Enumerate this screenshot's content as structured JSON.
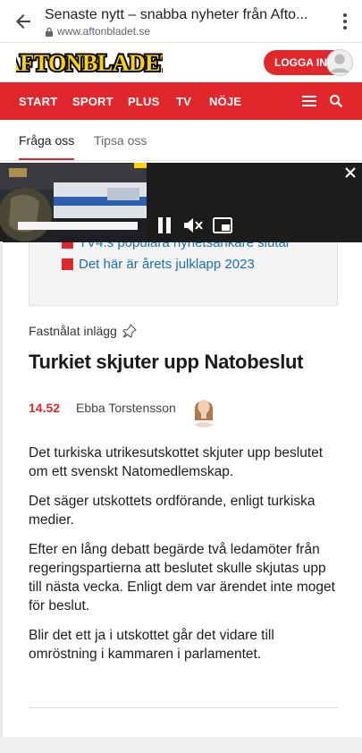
{
  "browser": {
    "page_title": "Senaste nytt – snabba nyheter från Afto...",
    "url": "www.aftonbladet.se"
  },
  "header": {
    "logo_text": "AFTONBLADET",
    "login_label": "LOGGA IN"
  },
  "nav": {
    "items": [
      "START",
      "SPORT",
      "PLUS",
      "TV",
      "NÖJE"
    ]
  },
  "subnav": {
    "tabs": [
      "Fråga oss",
      "Tipsa oss"
    ]
  },
  "related": {
    "links": [
      "TV4:s populära nyhetsankare slutar",
      "Det här är årets julklapp 2023"
    ]
  },
  "article": {
    "pinned_label": "Fastnålat inlägg",
    "headline": "Turkiet skjuter upp Natobeslut",
    "time": "14.52",
    "author": "Ebba Torstensson",
    "paragraphs": [
      "Det turkiska utrikesutskottet skjuter upp beslutet om ett svenskt Natomedlemskap.",
      "Det säger utskottets ordförande, enligt turkiska medier.",
      "Efter en lång debatt begärde två ledamöter från regeringspartierna att beslutet skulle skjutas upp till nästa vecka. Enligt dem var ärendet inte moget för beslut.",
      "Blir det ett ja i utskottet går det vidare till omröstning i kammaren i parlamentet."
    ]
  },
  "colors": {
    "brand_red": "#e0282c",
    "link_blue": "#1a6fb3",
    "logo_yellow": "#ffd200"
  },
  "icons": {
    "back": "arrow-left-icon",
    "lock": "lock-icon",
    "menu": "kebab-menu-icon",
    "hamburger": "hamburger-icon",
    "search": "search-icon",
    "pin": "pin-icon",
    "pause": "pause-icon",
    "mute": "mute-icon",
    "pip": "picture-in-picture-icon",
    "close": "close-icon"
  }
}
